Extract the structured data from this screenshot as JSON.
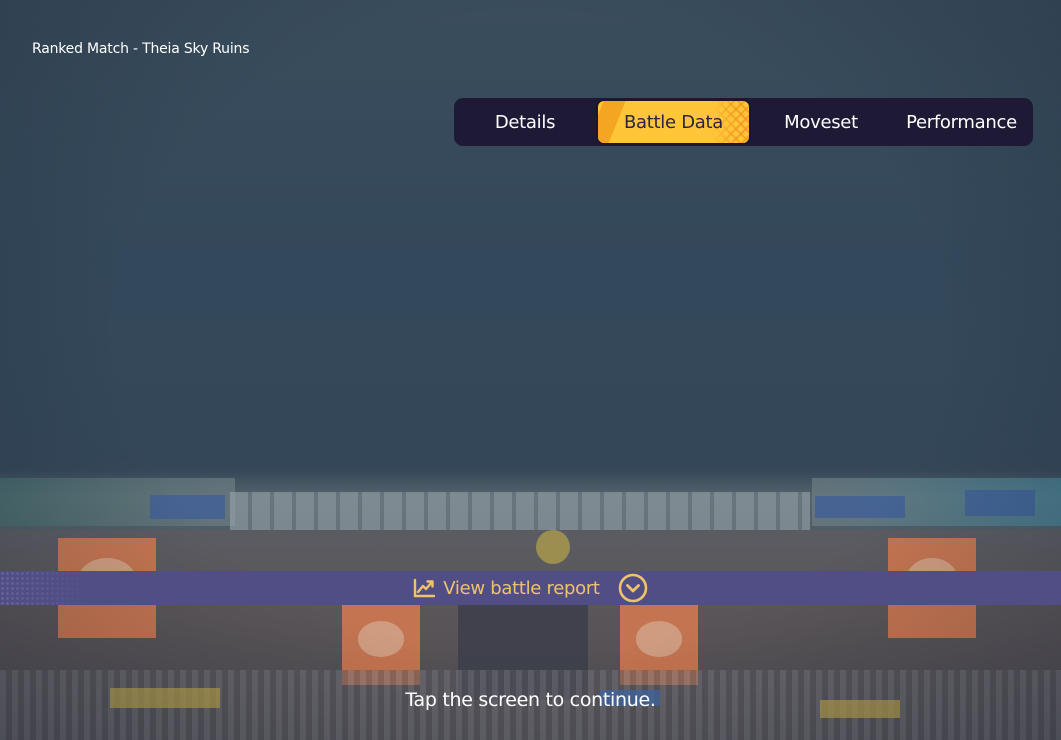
{
  "header": {
    "match_title": "Ranked Match - Theia Sky Ruins"
  },
  "tabs": {
    "details": "Details",
    "battle_data": "Battle Data",
    "moveset": "Moveset",
    "performance": "Performance",
    "active": "Battle Data"
  },
  "report": {
    "label": "View battle report",
    "icon": "line-chart-icon",
    "toggle_icon": "chevron-down-circle-icon"
  },
  "footer": {
    "prompt": "Tap the screen to continue."
  },
  "colors": {
    "tab_active": "#ffc63a",
    "tabbar_bg": "#1e1a36",
    "report_bar": "#514e86",
    "report_text": "#f0c36a"
  }
}
